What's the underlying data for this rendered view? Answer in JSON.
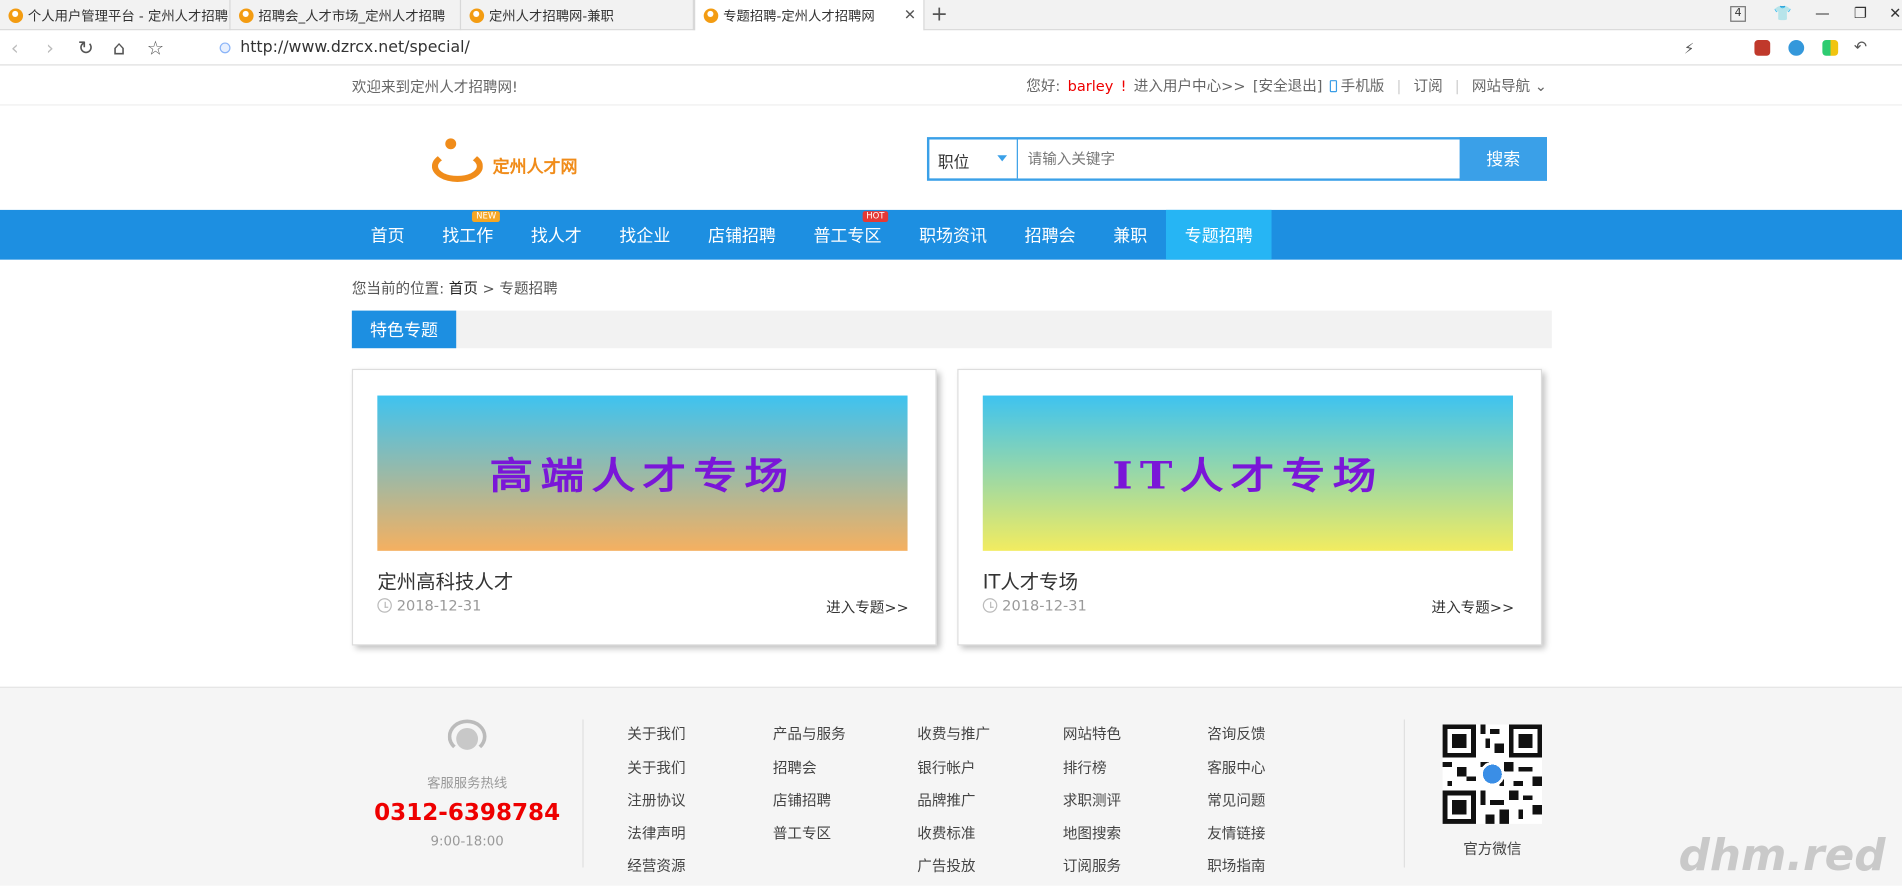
{
  "browser": {
    "tabs": [
      {
        "title": "个人用户管理平台 - 定州人才招聘"
      },
      {
        "title": "招聘会_人才市场_定州人才招聘"
      },
      {
        "title": "定州人才招聘网-兼职"
      },
      {
        "title": "专题招聘-定州人才招聘网"
      }
    ],
    "tab_count": "4",
    "url": "http://www.dzrcx.net/special/"
  },
  "topbar": {
    "welcome": "欢迎来到定州人才招聘网!",
    "greeting": "您好:",
    "username": "barley",
    "user_center": "进入用户中心>>",
    "logout": "[安全退出]",
    "mobile": "手机版",
    "subscribe": "订阅",
    "site_nav": "网站导航"
  },
  "header": {
    "logo_text": "定州人才网",
    "search_category": "职位",
    "search_placeholder": "请输入关键字",
    "search_button": "搜索"
  },
  "nav": {
    "items": [
      {
        "label": "首页"
      },
      {
        "label": "找工作",
        "badge": "NEW"
      },
      {
        "label": "找人才"
      },
      {
        "label": "找企业"
      },
      {
        "label": "店铺招聘"
      },
      {
        "label": "普工专区",
        "badge": "HOT"
      },
      {
        "label": "职场资讯"
      },
      {
        "label": "招聘会"
      },
      {
        "label": "兼职"
      },
      {
        "label": "专题招聘"
      }
    ]
  },
  "breadcrumb": {
    "prefix": "您当前的位置:",
    "home": "首页",
    "sep": ">",
    "current": "专题招聘"
  },
  "section": {
    "title": "特色专题"
  },
  "cards": [
    {
      "banner": "高端人才专场",
      "title": "定州高科技人才",
      "date": "2018-12-31",
      "link": "进入专题>>",
      "colors": [
        "#3ec3f0",
        "#f5b060"
      ]
    },
    {
      "banner": "IT人才专场",
      "title": "IT人才专场",
      "date": "2018-12-31",
      "link": "进入专题>>",
      "colors": [
        "#3ec3f0",
        "#f2ec60"
      ]
    }
  ],
  "footer": {
    "hotline_label": "客服服务热线",
    "hotline_number": "0312-6398784",
    "hours": "9:00-18:00",
    "columns": [
      {
        "heading": "关于我们",
        "items": [
          "关于我们",
          "注册协议",
          "法律声明",
          "经营资源"
        ]
      },
      {
        "heading": "产品与服务",
        "items": [
          "招聘会",
          "店铺招聘",
          "普工专区"
        ]
      },
      {
        "heading": "收费与推广",
        "items": [
          "银行帐户",
          "品牌推广",
          "收费标准",
          "广告投放"
        ]
      },
      {
        "heading": "网站特色",
        "items": [
          "排行榜",
          "求职测评",
          "地图搜索",
          "订阅服务"
        ]
      },
      {
        "heading": "咨询反馈",
        "items": [
          "客服中心",
          "常见问题",
          "友情链接",
          "职场指南"
        ]
      }
    ],
    "qr_label": "官方微信"
  },
  "watermark": "dhm.red",
  "colors": {
    "nav_blue": "#1d8fe1",
    "nav_active": "#26b5f4",
    "accent_orange": "#f08c1a",
    "hotline_red": "#e00000"
  }
}
